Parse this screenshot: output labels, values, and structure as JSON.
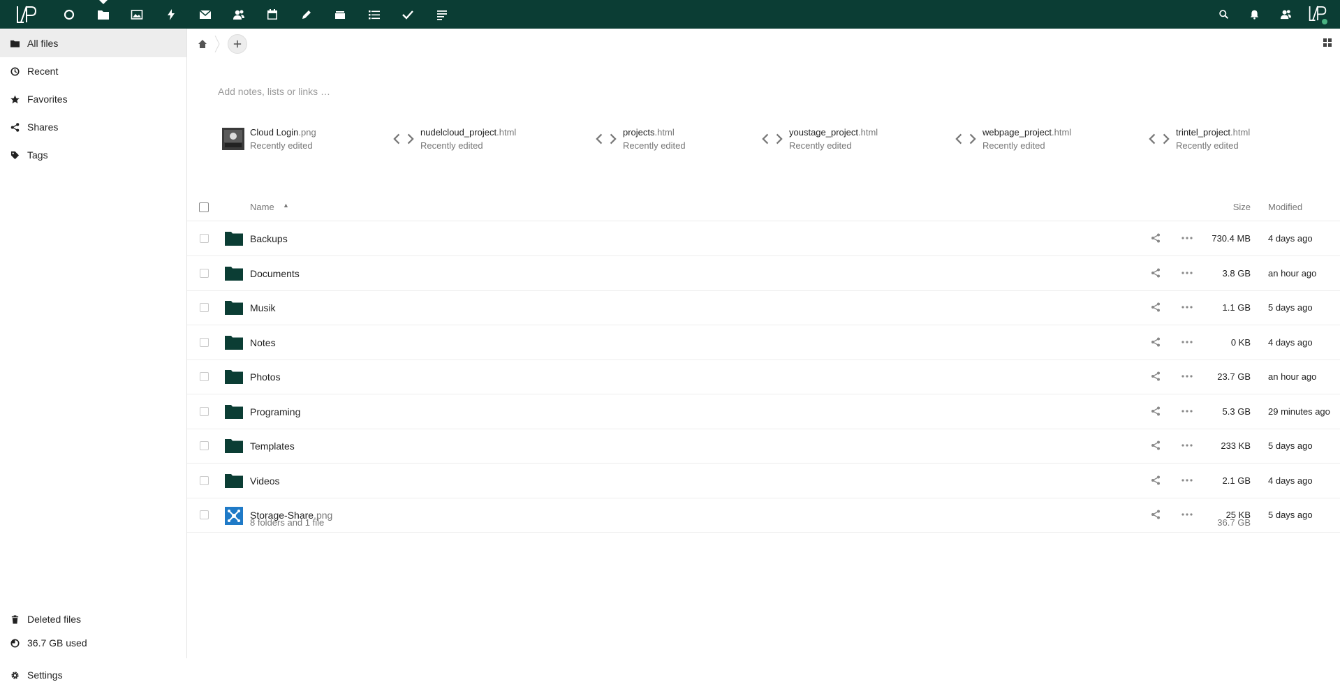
{
  "topbar": {
    "bg_color": "#0b3d34",
    "apps": [
      {
        "name": "dashboard",
        "icon": "circle-icon"
      },
      {
        "name": "files",
        "icon": "folder-icon"
      },
      {
        "name": "photos",
        "icon": "image-icon"
      },
      {
        "name": "activity",
        "icon": "lightning-icon"
      },
      {
        "name": "mail",
        "icon": "mail-icon"
      },
      {
        "name": "contacts",
        "icon": "contacts-icon"
      },
      {
        "name": "calendar",
        "icon": "calendar-icon"
      },
      {
        "name": "notes",
        "icon": "pencil-icon"
      },
      {
        "name": "deck",
        "icon": "stack-icon"
      },
      {
        "name": "tasks",
        "icon": "list-icon"
      },
      {
        "name": "checklist",
        "icon": "check-icon"
      },
      {
        "name": "text",
        "icon": "text-lines-icon"
      }
    ],
    "right_icons": [
      "search-icon",
      "bell-icon",
      "contacts-menu-icon"
    ]
  },
  "sidebar": {
    "items": [
      {
        "label": "All files",
        "icon": "folder-icon",
        "active": true
      },
      {
        "label": "Recent",
        "icon": "clock-icon"
      },
      {
        "label": "Favorites",
        "icon": "star-icon"
      },
      {
        "label": "Shares",
        "icon": "share-icon"
      },
      {
        "label": "Tags",
        "icon": "tag-icon"
      }
    ],
    "bottom": {
      "deleted": "Deleted files",
      "quota": "36.7 GB used",
      "settings": "Settings"
    }
  },
  "main": {
    "notes_placeholder": "Add notes, lists or links …",
    "recent_files": [
      {
        "base": "Cloud Login",
        "ext": ".png",
        "sub": "Recently edited",
        "type": "image"
      },
      {
        "base": "nudelcloud_project",
        "ext": ".html",
        "sub": "Recently edited",
        "type": "code"
      },
      {
        "base": "projects",
        "ext": ".html",
        "sub": "Recently edited",
        "type": "code"
      },
      {
        "base": "youstage_project",
        "ext": ".html",
        "sub": "Recently edited",
        "type": "code"
      },
      {
        "base": "webpage_project",
        "ext": ".html",
        "sub": "Recently edited",
        "type": "code"
      },
      {
        "base": "trintel_project",
        "ext": ".html",
        "sub": "Recently edited",
        "type": "code"
      }
    ],
    "table": {
      "headers": {
        "name": "Name",
        "size": "Size",
        "modified": "Modified"
      },
      "rows": [
        {
          "base": "Backups",
          "ext": "",
          "type": "folder",
          "size": "730.4 MB",
          "modified": "4 days ago"
        },
        {
          "base": "Documents",
          "ext": "",
          "type": "folder",
          "size": "3.8 GB",
          "modified": "an hour ago"
        },
        {
          "base": "Musik",
          "ext": "",
          "type": "folder",
          "size": "1.1 GB",
          "modified": "5 days ago"
        },
        {
          "base": "Notes",
          "ext": "",
          "type": "folder",
          "size": "0 KB",
          "modified": "4 days ago"
        },
        {
          "base": "Photos",
          "ext": "",
          "type": "folder",
          "size": "23.7 GB",
          "modified": "an hour ago"
        },
        {
          "base": "Programing",
          "ext": "",
          "type": "folder",
          "size": "5.3 GB",
          "modified": "29 minutes ago"
        },
        {
          "base": "Templates",
          "ext": "",
          "type": "folder",
          "size": "233 KB",
          "modified": "5 days ago"
        },
        {
          "base": "Videos",
          "ext": "",
          "type": "folder",
          "size": "2.1 GB",
          "modified": "4 days ago"
        },
        {
          "base": "Storage-Share",
          "ext": ".png",
          "type": "image",
          "size": "25 KB",
          "modified": "5 days ago"
        }
      ],
      "summary": "8 folders and 1 file",
      "summary_size": "36.7 GB"
    },
    "folder_color": "#0b3d34"
  }
}
